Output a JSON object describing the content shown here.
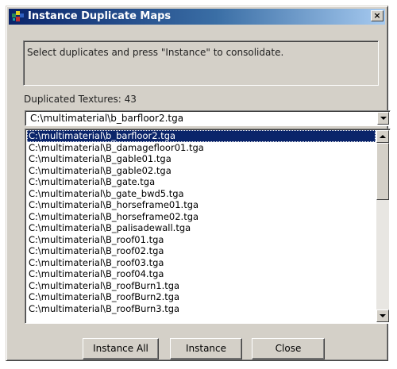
{
  "window": {
    "title": "Instance Duplicate Maps",
    "close_glyph": "×"
  },
  "instructions": "Select duplicates and press \"Instance\" to consolidate.",
  "duplicated_label": "Duplicated Textures: 43",
  "combo": {
    "value": "C:\\multimaterial\\b_barfloor2.tga"
  },
  "list": {
    "selected_index": 0,
    "items": [
      "C:\\multimaterial\\b_barfloor2.tga",
      "C:\\multimaterial\\B_damagefloor01.tga",
      "C:\\multimaterial\\B_gable01.tga",
      "C:\\multimaterial\\B_gable02.tga",
      "C:\\multimaterial\\B_gate.tga",
      "C:\\multimaterial\\b_gate_bwd5.tga",
      "C:\\multimaterial\\B_horseframe01.tga",
      "C:\\multimaterial\\B_horseframe02.tga",
      "C:\\multimaterial\\B_palisadewall.tga",
      "C:\\multimaterial\\B_roof01.tga",
      "C:\\multimaterial\\B_roof02.tga",
      "C:\\multimaterial\\B_roof03.tga",
      "C:\\multimaterial\\B_roof04.tga",
      "C:\\multimaterial\\B_roofBurn1.tga",
      "C:\\multimaterial\\B_roofBurn2.tga",
      "C:\\multimaterial\\B_roofBurn3.tga"
    ]
  },
  "buttons": {
    "instance_all": "Instance All",
    "instance": "Instance",
    "close": "Close"
  },
  "icons": {
    "app": "app-icon",
    "close": "close-icon",
    "dropdown": "chevron-down-icon",
    "scroll_up": "scroll-up-icon",
    "scroll_down": "scroll-down-icon"
  },
  "colors": {
    "title_start": "#0a246a",
    "title_end": "#a6caf0",
    "face": "#d4d0c8",
    "selection": "#0a246a"
  }
}
